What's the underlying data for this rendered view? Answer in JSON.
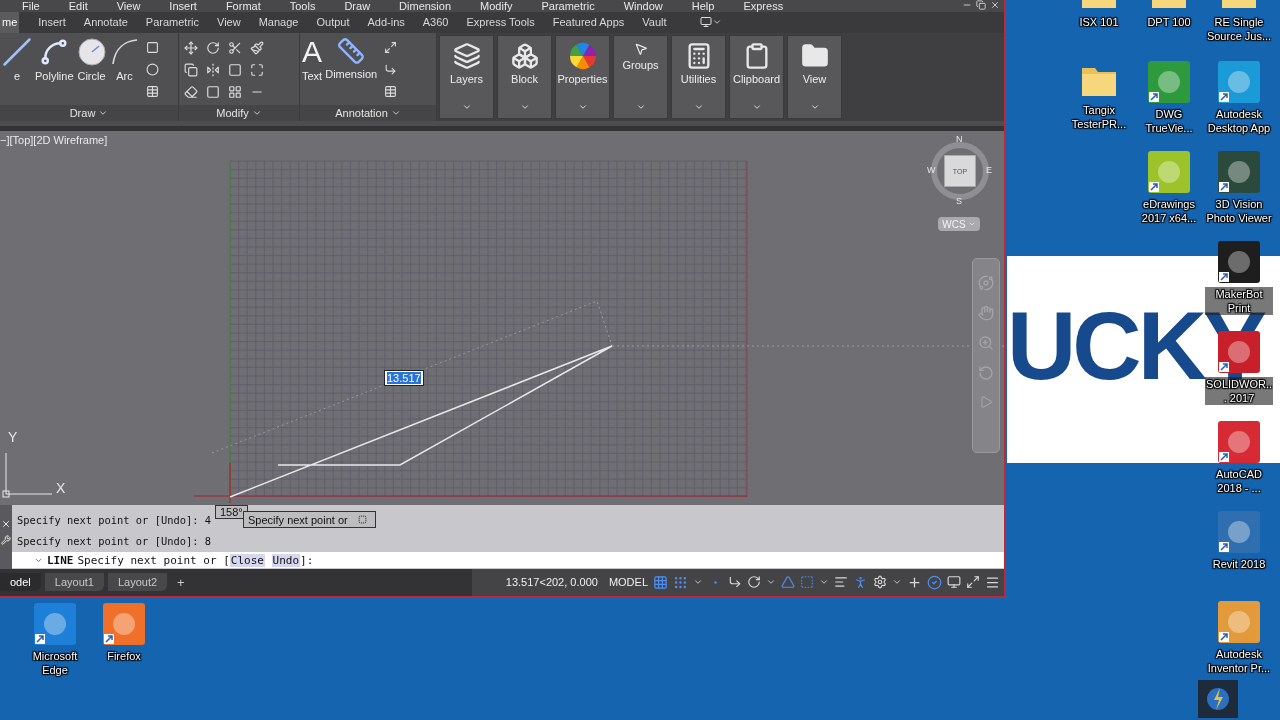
{
  "autocad": {
    "menu": [
      "File",
      "Edit",
      "View",
      "Insert",
      "Format",
      "Tools",
      "Draw",
      "Dimension",
      "Modify",
      "Parametric",
      "Window",
      "Help",
      "Express"
    ],
    "tabs": [
      {
        "label": "me",
        "selected": true
      },
      {
        "label": "Insert",
        "selected": false
      },
      {
        "label": "Annotate",
        "selected": false
      },
      {
        "label": "Parametric",
        "selected": false
      },
      {
        "label": "View",
        "selected": false
      },
      {
        "label": "Manage",
        "selected": false
      },
      {
        "label": "Output",
        "selected": false
      },
      {
        "label": "Add-ins",
        "selected": false
      },
      {
        "label": "A360",
        "selected": false
      },
      {
        "label": "Express Tools",
        "selected": false
      },
      {
        "label": "Featured Apps",
        "selected": false
      },
      {
        "label": "Vault",
        "selected": false
      }
    ],
    "ribbon": {
      "draw_panel": {
        "title": "Draw",
        "tools": [
          {
            "kind": "line",
            "label": "e"
          },
          {
            "kind": "polyline",
            "label": "Polyline"
          },
          {
            "kind": "circle",
            "label": "Circle"
          },
          {
            "kind": "arc",
            "label": "Arc"
          }
        ]
      },
      "modify_panel": {
        "title": "Modify"
      },
      "annotation_panel": {
        "title": "Annotation",
        "text_glyph": "A",
        "tools": [
          "Text",
          "Dimension"
        ]
      },
      "big_panels": [
        {
          "kind": "layers",
          "label": "Layers"
        },
        {
          "kind": "block",
          "label": "Block"
        },
        {
          "kind": "properties",
          "label": "Properties"
        },
        {
          "kind": "groups",
          "label": "Groups"
        },
        {
          "kind": "utilities",
          "label": "Utilities"
        },
        {
          "kind": "clipboard",
          "label": "Clipboard"
        },
        {
          "kind": "view",
          "label": "View"
        }
      ]
    },
    "viewport": {
      "label": "−][Top][2D Wireframe]",
      "viewcube": {
        "top": "TOP",
        "n": "N",
        "s": "S",
        "e": "E",
        "w": "W",
        "ucs_menu": "WCS"
      },
      "ucs": {
        "y": "Y",
        "x": "X"
      },
      "dimension_input": "13.517",
      "angle_tooltip": "158°",
      "prompt_tooltip": "Specify next point or"
    },
    "command": {
      "history": [
        "Specify next point or [Undo]: 4",
        "Specify next point or [Undo]: 8"
      ],
      "line": {
        "command": "LINE",
        "before": "Specify next point or [",
        "options": [
          "Close",
          "Undo"
        ],
        "after": "]:"
      }
    },
    "status": {
      "layout_tabs": [
        {
          "label": "odel",
          "selected": true
        },
        {
          "label": "Layout1",
          "selected": false
        },
        {
          "label": "Layout2",
          "selected": false
        }
      ],
      "add_tab": "+",
      "coordinates": "13.517<202, 0.000",
      "space": "MODEL"
    }
  },
  "desktop": {
    "banner_text": "UCKY",
    "icons": [
      {
        "kind": "folder",
        "label": "ISX 101"
      },
      {
        "kind": "folder",
        "label": "DPT 100"
      },
      {
        "kind": "folder",
        "label": "RE  Single Source Jus..."
      },
      {
        "kind": "folder",
        "label": "Tangix TesterPR..."
      },
      {
        "kind": "app",
        "label": "DWG TrueVie...",
        "color": "#2e9a3e"
      },
      {
        "kind": "app",
        "label": "Autodesk Desktop App",
        "color": "#1a9ad6"
      },
      {
        "kind": "app",
        "label": "eDrawings 2017 x64...",
        "color": "#9cc42a"
      },
      {
        "kind": "app",
        "label": "3D Vision Photo Viewer",
        "color": "#2b4a3c"
      },
      {
        "kind": "app",
        "label": "MakerBot Print",
        "color": "#1e1e1e"
      },
      {
        "kind": "app",
        "label": "SOLIDWOR... 2017",
        "color": "#c8202a"
      },
      {
        "kind": "app",
        "label": "AutoCAD 2018 - ...",
        "color": "#d62b35"
      },
      {
        "kind": "app",
        "label": "Revit 2018",
        "color": "#2f6fb0"
      },
      {
        "kind": "app",
        "label": "Microsoft Edge",
        "color": "#1d7fd8"
      },
      {
        "kind": "app",
        "label": "Firefox",
        "color": "#f0702a"
      },
      {
        "kind": "app",
        "label": "Autodesk Inventor Pr...",
        "color": "#e39a3a"
      }
    ]
  }
}
